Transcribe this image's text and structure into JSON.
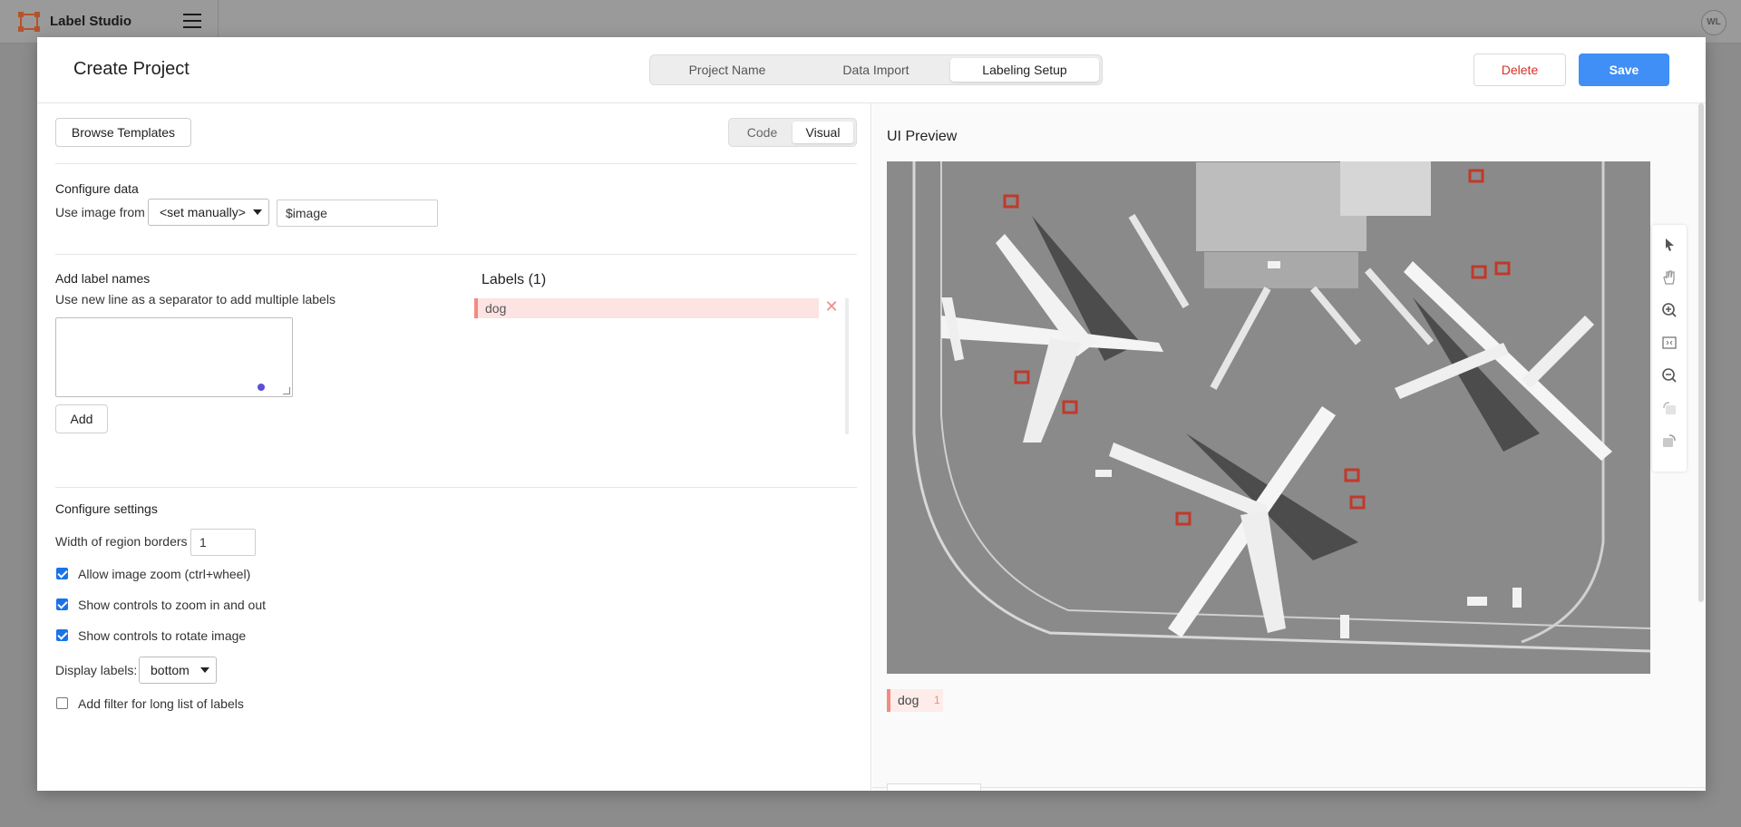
{
  "app": {
    "brand": "Label Studio",
    "avatar_initials": "WL"
  },
  "modal": {
    "title": "Create Project",
    "steps": [
      {
        "label": "Project Name",
        "active": false
      },
      {
        "label": "Data Import",
        "active": false
      },
      {
        "label": "Labeling Setup",
        "active": true
      }
    ],
    "delete_label": "Delete",
    "save_label": "Save"
  },
  "config": {
    "browse_templates_label": "Browse Templates",
    "view_toggle": [
      {
        "label": "Code",
        "active": false
      },
      {
        "label": "Visual",
        "active": true
      }
    ],
    "configure_data": {
      "heading": "Configure data",
      "use_image_from_label": "Use image from",
      "source_select": "<set manually>",
      "variable_value": "$image"
    },
    "add_labels": {
      "heading": "Add label names",
      "hint": "Use new line as a separator to add multiple labels",
      "textarea_value": "",
      "add_label": "Add"
    },
    "labels_panel": {
      "title": "Labels (1)",
      "items": [
        {
          "name": "dog",
          "color": "#f28b82"
        }
      ]
    },
    "settings": {
      "heading": "Configure settings",
      "border_width_label": "Width of region borders",
      "border_width_value": "1",
      "options": [
        {
          "label": "Allow image zoom (ctrl+wheel)",
          "checked": true
        },
        {
          "label": "Show controls to zoom in and out",
          "checked": true
        },
        {
          "label": "Show controls to rotate image",
          "checked": true
        }
      ],
      "display_labels_label": "Display labels:",
      "display_labels_value": "bottom",
      "filter_option": {
        "label": "Add filter for long list of labels",
        "checked": false
      }
    }
  },
  "preview": {
    "title": "UI Preview",
    "tools": [
      "pointer-icon",
      "hand-icon",
      "zoom-in-icon",
      "fit-icon",
      "zoom-out-icon",
      "rotate-left-icon",
      "rotate-right-icon"
    ],
    "label_chip": {
      "name": "dog",
      "hotkey": "1"
    }
  },
  "colors": {
    "accent": "#3f8ff7",
    "delete": "#d93025",
    "label_dog": "#f28b82"
  }
}
